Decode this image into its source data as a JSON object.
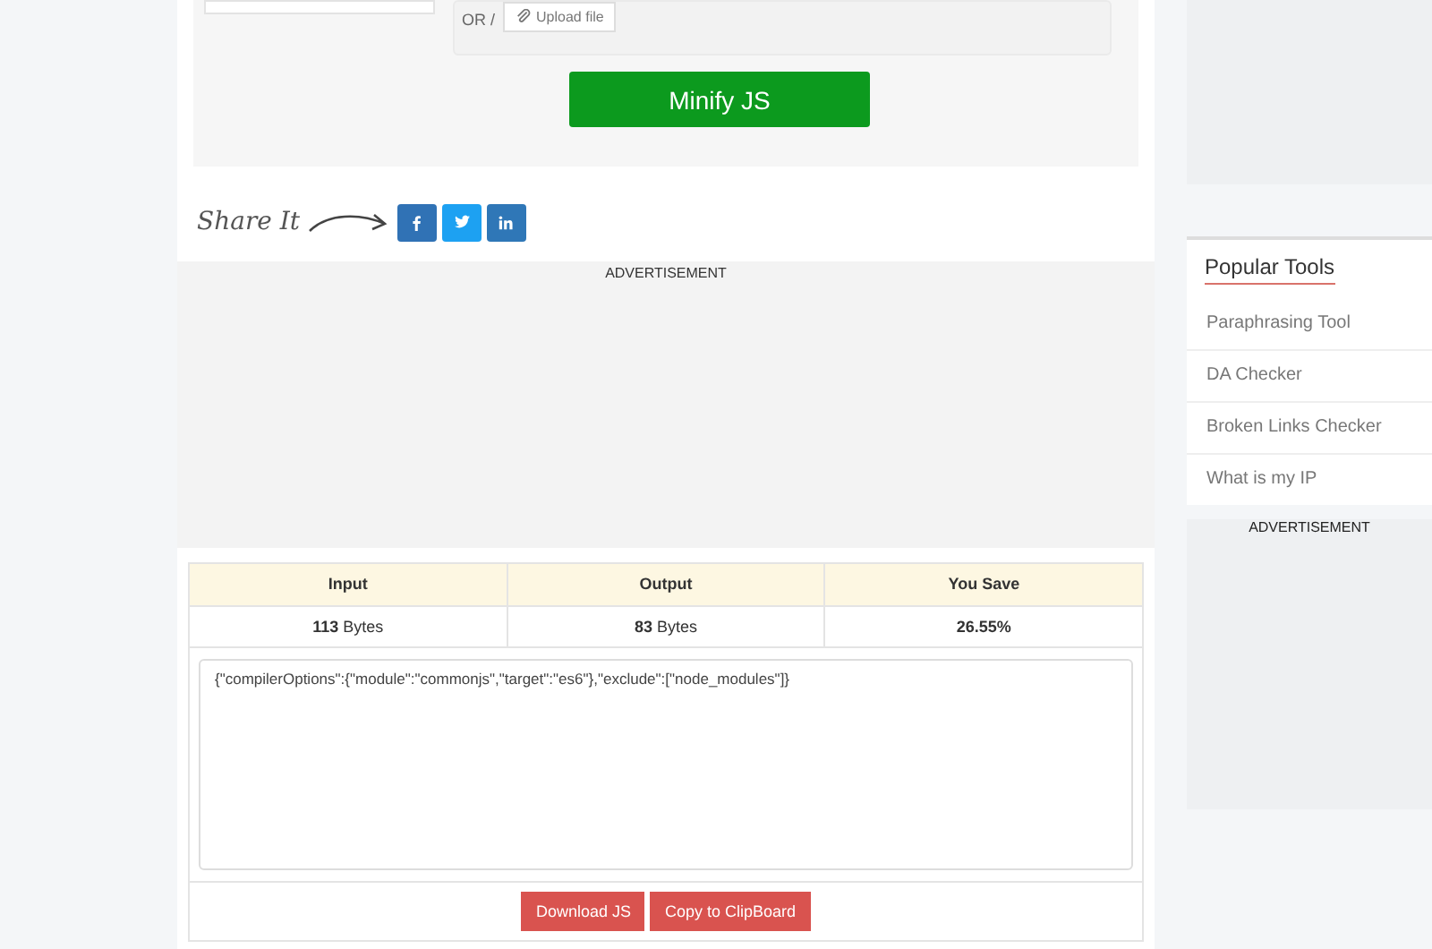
{
  "upload": {
    "separator": "OR /",
    "button": "Upload file"
  },
  "minify_button": "Minify JS",
  "share": {
    "label": "Share It",
    "buttons": [
      {
        "kind": "facebook",
        "color": "#3072b5"
      },
      {
        "kind": "twitter",
        "color": "#1da1f2"
      },
      {
        "kind": "linkedin",
        "color": "#2f77b7"
      }
    ]
  },
  "ad_label": "ADVERTISEMENT",
  "results": {
    "columns": [
      "Input",
      "Output",
      "You Save"
    ],
    "values": [
      "**113** Bytes",
      "**83** Bytes",
      "**26.55%**"
    ],
    "output": "{\"compilerOptions\":{\"module\":\"commonjs\",\"target\":\"es6\"},\"exclude\":[\"node_modules\"]}",
    "buttons": [
      "Download JS",
      "Copy to ClipBoard"
    ]
  },
  "sidebar": {
    "title": "Popular Tools",
    "items": [
      "Paraphrasing Tool",
      "DA Checker",
      "Broken Links Checker",
      "What is my IP"
    ],
    "ad_label": "ADVERTISEMENT"
  }
}
